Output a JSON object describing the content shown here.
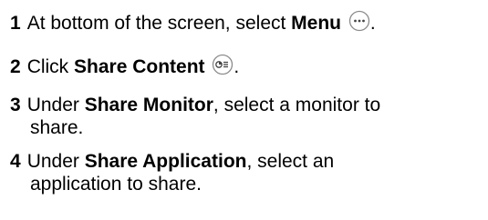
{
  "steps": [
    {
      "number": "1",
      "pre": "At bottom of the screen, select ",
      "bold": "Menu",
      "post": ".",
      "icon": "more-icon"
    },
    {
      "number": "2",
      "pre": "Click ",
      "bold": "Share Content",
      "post": ".",
      "icon": "share-content-icon"
    },
    {
      "number": "3",
      "pre": "Under ",
      "bold": "Share Monitor",
      "post": ", select a monitor to",
      "cont": "share."
    },
    {
      "number": "4",
      "pre": "Under ",
      "bold": "Share Application",
      "post": ", select an",
      "cont": "application to share."
    }
  ]
}
